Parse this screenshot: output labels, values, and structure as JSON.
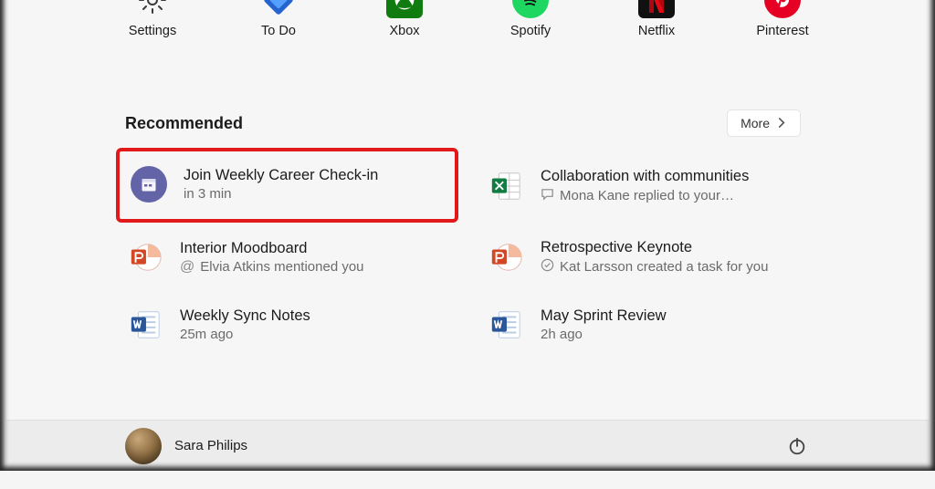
{
  "pinned": [
    {
      "id": "settings",
      "label": "Settings"
    },
    {
      "id": "todo",
      "label": "To Do"
    },
    {
      "id": "xbox",
      "label": "Xbox"
    },
    {
      "id": "spotify",
      "label": "Spotify"
    },
    {
      "id": "netflix",
      "label": "Netflix"
    },
    {
      "id": "pinterest",
      "label": "Pinterest"
    }
  ],
  "recommended": {
    "header": "Recommended",
    "more_label": "More",
    "items": [
      {
        "title": "Join Weekly Career Check-in",
        "sub": "in 3 min",
        "icon": "teams-calendar",
        "sub_icon": null,
        "highlighted": true
      },
      {
        "title": "Collaboration with communities",
        "sub": "Mona Kane replied to your…",
        "icon": "excel",
        "sub_icon": "comment",
        "highlighted": false
      },
      {
        "title": "Interior Moodboard",
        "sub": "Elvia Atkins mentioned you",
        "icon": "powerpoint",
        "sub_icon": "mention",
        "highlighted": false
      },
      {
        "title": "Retrospective Keynote",
        "sub": "Kat Larsson created a task for you",
        "icon": "powerpoint",
        "sub_icon": "check",
        "highlighted": false
      },
      {
        "title": "Weekly Sync Notes",
        "sub": "25m ago",
        "icon": "word",
        "sub_icon": null,
        "highlighted": false
      },
      {
        "title": "May Sprint Review",
        "sub": "2h ago",
        "icon": "word",
        "sub_icon": null,
        "highlighted": false
      }
    ]
  },
  "footer": {
    "user_name": "Sara Philips"
  },
  "colors": {
    "highlight": "#e1191b",
    "teams": "#6264a7",
    "excel": "#107c41",
    "ppt": "#d24726",
    "word": "#2b579a",
    "spotify": "#1ed760",
    "netflix": "#111111",
    "pinterest": "#e60023",
    "xbox": "#107c10",
    "todo": "#2564cf"
  }
}
